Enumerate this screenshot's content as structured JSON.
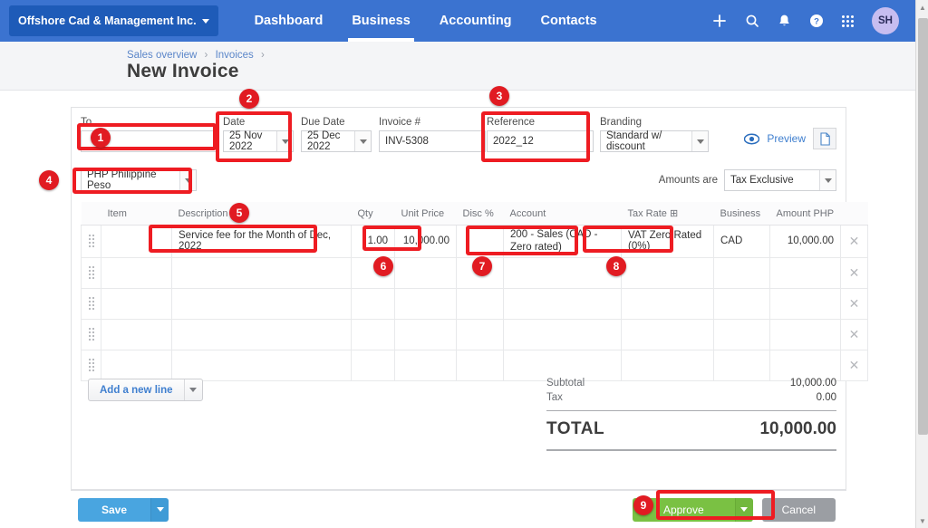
{
  "topbar": {
    "org_name": "Offshore Cad & Management Inc.",
    "nav": [
      {
        "label": "Dashboard",
        "active": false
      },
      {
        "label": "Business",
        "active": true
      },
      {
        "label": "Accounting",
        "active": false
      },
      {
        "label": "Contacts",
        "active": false
      }
    ],
    "icons": [
      "plus-icon",
      "search-icon",
      "bell-icon",
      "help-icon",
      "apps-grid-icon"
    ],
    "avatar_initials": "SH",
    "bg_color": "#3b73d0"
  },
  "breadcrumb": {
    "item1": "Sales overview",
    "item2": "Invoices",
    "separator": "›"
  },
  "page_title": "New Invoice",
  "form": {
    "to": {
      "label": "To",
      "value": "",
      "placeholder": ""
    },
    "date": {
      "label": "Date",
      "value": "25 Nov 2022"
    },
    "due_date": {
      "label": "Due Date",
      "value": "25 Dec 2022"
    },
    "invoice_no": {
      "label": "Invoice #",
      "value": "INV-5308"
    },
    "reference": {
      "label": "Reference",
      "value": "2022_12"
    },
    "branding": {
      "label": "Branding",
      "value": "Standard w/ discount"
    },
    "preview_label": "Preview",
    "currency": {
      "value": "PHP Philippine Peso"
    },
    "amounts_are": {
      "label": "Amounts are",
      "value": "Tax Exclusive"
    }
  },
  "line_table": {
    "columns": [
      "",
      "Item",
      "Description",
      "Qty",
      "Unit Price",
      "Disc %",
      "Account",
      "Tax Rate ⊞",
      "Business",
      "Amount PHP",
      ""
    ],
    "rows": [
      {
        "item": "",
        "description": "Service fee for the Month of Dec, 2022",
        "qty": "1.00",
        "unit_price": "10,000.00",
        "disc": "",
        "account": "200 - Sales (CAD - Zero rated)",
        "tax_rate": "VAT Zero Rated (0%)",
        "business": "CAD",
        "amount": "10,000.00"
      },
      {
        "item": "",
        "description": "",
        "qty": "",
        "unit_price": "",
        "disc": "",
        "account": "",
        "tax_rate": "",
        "business": "",
        "amount": ""
      },
      {
        "item": "",
        "description": "",
        "qty": "",
        "unit_price": "",
        "disc": "",
        "account": "",
        "tax_rate": "",
        "business": "",
        "amount": ""
      },
      {
        "item": "",
        "description": "",
        "qty": "",
        "unit_price": "",
        "disc": "",
        "account": "",
        "tax_rate": "",
        "business": "",
        "amount": ""
      },
      {
        "item": "",
        "description": "",
        "qty": "",
        "unit_price": "",
        "disc": "",
        "account": "",
        "tax_rate": "",
        "business": "",
        "amount": ""
      }
    ]
  },
  "add_line_label": "Add a new line",
  "totals": {
    "subtotal_label": "Subtotal",
    "subtotal_value": "10,000.00",
    "tax_label": "Tax",
    "tax_value": "0.00",
    "total_label": "TOTAL",
    "total_value": "10,000.00"
  },
  "footer": {
    "save_label": "Save",
    "approve_label": "Approve",
    "cancel_label": "Cancel",
    "approve_color": "#7ac143",
    "save_color": "#49a5e0",
    "cancel_color": "#9b9ea3"
  },
  "annotations": {
    "color": "#e11b22",
    "badges": [
      {
        "n": "1"
      },
      {
        "n": "2"
      },
      {
        "n": "3"
      },
      {
        "n": "4"
      },
      {
        "n": "5"
      },
      {
        "n": "6"
      },
      {
        "n": "7"
      },
      {
        "n": "8"
      },
      {
        "n": "9"
      }
    ]
  }
}
